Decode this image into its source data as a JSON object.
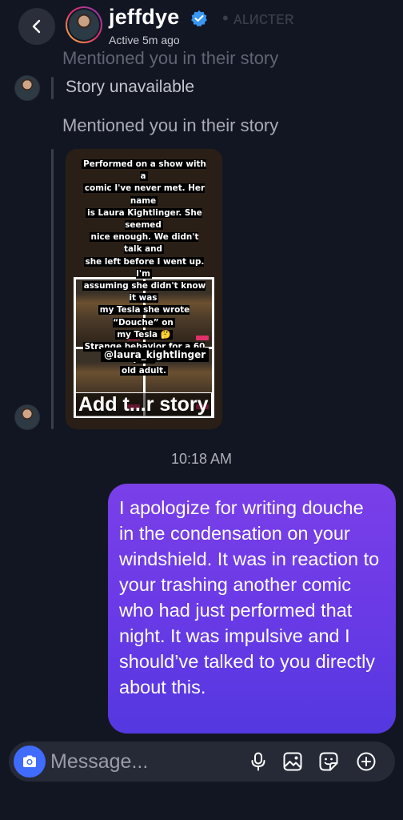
{
  "header": {
    "username": "jeffdye",
    "status": "Active 5m ago",
    "ghost_text": "• ᴀʟᴎᴄᴛᴇʀ"
  },
  "thread": {
    "ghost_mention": "Mentioned you in their story",
    "story_unavailable": "Story unavailable",
    "mention_label": "Mentioned you in their story",
    "story": {
      "caption_lines": [
        "Performed on a show with a",
        "comic I've never met. Her name",
        "is Laura Kightlinger. She seemed",
        "nice enough. We didn't talk and",
        "she left before I went up. I'm",
        "assuming she didn't know it was",
        "my Tesla she wrote “Douche” on",
        "my Tesla 🤔",
        "Strange behavior for a 60 year",
        "old adult."
      ],
      "mention_sticker": "@laura_kightlinger",
      "add_story_label": "Add t...r story"
    },
    "timestamp": "10:18 AM",
    "outgoing_message": "I apologize for writing douche in the condensation on your windshield. It was in reaction to your trashing another comic who had just performed that night. It was impulsive and I should’ve talked to you directly about this."
  },
  "composer": {
    "placeholder": "Message..."
  },
  "icons": {
    "back": "chevron-left-icon",
    "verified": "verified-badge-icon",
    "camera": "camera-icon",
    "mic": "microphone-icon",
    "gallery": "image-icon",
    "sticker": "sticker-icon",
    "add": "plus-circle-icon"
  },
  "colors": {
    "background": "#121622",
    "bubble_top": "#7a3fe8",
    "bubble_bottom": "#5438e0",
    "verified": "#3897f0",
    "camera_button": "#3f6bff"
  }
}
